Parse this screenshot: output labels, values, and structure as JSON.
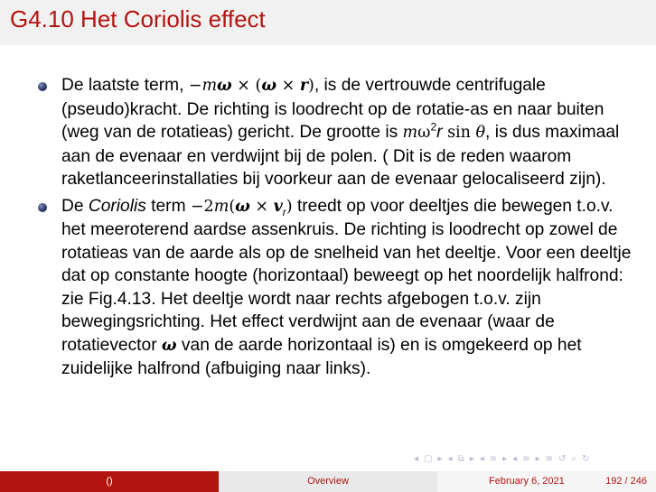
{
  "slide": {
    "title": "G4.10 Het Coriolis effect",
    "bullets": [
      {
        "t1": "De laatste term, ",
        "m_minus": "−",
        "m_m": "m",
        "m_omega": "ω",
        "m_times1": " × (",
        "m_omega2": "ω",
        "m_times2": " × ",
        "m_r": "r",
        "m_close": ")",
        "t2": ", is de vertrouwde centrifugale (pseudo)kracht. De richting is loodrecht op de rotatie-as en naar buiten (weg van de rotatieas) gericht. De grootte is ",
        "g_m": "m",
        "g_omega": "ω",
        "g_exp": "2",
        "g_r": "r",
        "g_sin": " sin ",
        "g_theta": "θ",
        "t3": ", is dus maximaal aan de evenaar en verdwijnt bij de polen. ( Dit is de reden waarom raketlanceerinstallaties bij voorkeur aan de evenaar gelocaliseerd zijn)."
      },
      {
        "t1": "De ",
        "coriolis": "Coriolis",
        "t2": " term ",
        "m_coef": "−2",
        "m_m": "m",
        "m_open": "(",
        "m_omega": "ω",
        "m_times": " × ",
        "m_v": "v",
        "m_sub": "r",
        "m_close": ")",
        "t3": " treedt op voor deeltjes die bewegen t.o.v. het meeroterend aardse assenkruis. De richting is loodrecht op zowel de rotatieas van de aarde als op de snelheid van het deeltje. Voor een deeltje dat op constante hoogte (horizontaal) beweegt op het noordelijk halfrond: zie Fig.4.13. Het deeltje wordt naar rechts afgebogen t.o.v. zijn bewegingsrichting. Het effect verdwijnt aan de evenaar (waar de rotatievector ",
        "w_omega": "ω",
        "t4": " van de aarde horizontaal is) en is omgekeerd op het zuidelijke halfrond (afbuiging naar links)."
      }
    ]
  },
  "nav": {
    "icons": [
      "◂",
      "▢",
      "▸",
      "◂",
      "⧉",
      "▸",
      "◂",
      "≡",
      "▸",
      "◂",
      "≡",
      "▸",
      "≡",
      "↺",
      "⌕",
      "↻"
    ]
  },
  "footer": {
    "left": "()",
    "center": "Overview",
    "date": "February 6, 2021",
    "page": "192 / 246"
  },
  "colors": {
    "accent": "#b2140f",
    "title_bar": "#f1f1f1",
    "bullet": "#2f3a6e"
  }
}
